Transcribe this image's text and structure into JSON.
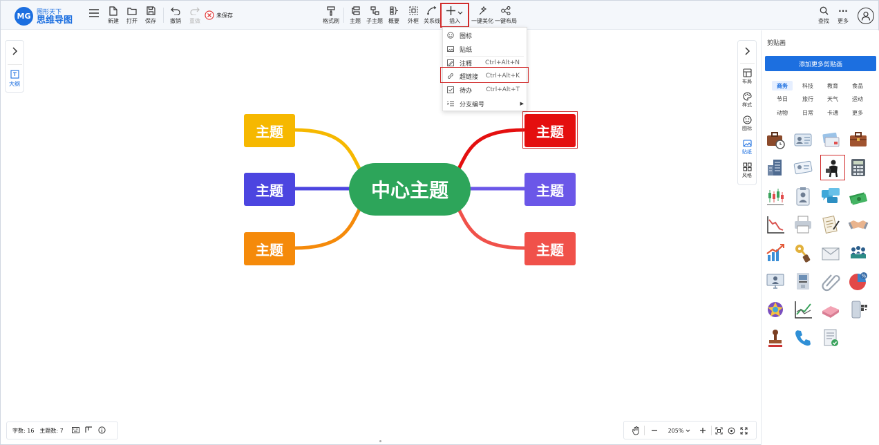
{
  "app": {
    "logo_mark": "MG",
    "logo_sub": "图形天下",
    "logo_main": "思维导图"
  },
  "toolbar": {
    "new": "新建",
    "open": "打开",
    "save": "保存",
    "undo": "撤销",
    "redo": "重做",
    "unsaved": "未保存",
    "format_painter": "格式刷",
    "topic": "主题",
    "subtopic": "子主题",
    "summary": "概要",
    "boundary": "外框",
    "relation": "关系线",
    "insert": "插入",
    "beautify": "一键美化",
    "layout": "一键布局",
    "find": "查找",
    "more": "更多"
  },
  "insert_menu": {
    "items": [
      {
        "label": "图标",
        "shortcut": "",
        "icon": "smiley-icon"
      },
      {
        "label": "贴纸",
        "shortcut": "",
        "icon": "image-icon"
      },
      {
        "label": "注释",
        "shortcut": "Ctrl+Alt+N",
        "icon": "note-icon"
      },
      {
        "label": "超链接",
        "shortcut": "Ctrl+Alt+K",
        "icon": "link-icon"
      },
      {
        "label": "待办",
        "shortcut": "Ctrl+Alt+T",
        "icon": "checkbox-icon"
      },
      {
        "label": "分支编号",
        "shortcut": "",
        "icon": "numbering-icon"
      }
    ]
  },
  "left_panel": {
    "outline": "大纲"
  },
  "right_panel": {
    "layout": "布局",
    "style": "样式",
    "icon": "图标",
    "sticker": "贴纸",
    "theme": "风格"
  },
  "mindmap": {
    "center": "中心主题",
    "topics": [
      {
        "label": "主题",
        "color": "#f6b800"
      },
      {
        "label": "主题",
        "color": "#4c45e0"
      },
      {
        "label": "主题",
        "color": "#f58a0a"
      },
      {
        "label": "主题",
        "color": "#e40f0f"
      },
      {
        "label": "主题",
        "color": "#6b57e8"
      },
      {
        "label": "主题",
        "color": "#f0514a"
      }
    ],
    "center_color": "#2da55a"
  },
  "sidebar": {
    "title": "剪贴画",
    "add_button": "添加更多剪贴画",
    "categories": [
      "商务",
      "科技",
      "教育",
      "食品",
      "节日",
      "旅行",
      "天气",
      "运动",
      "动物",
      "日常",
      "卡通",
      "更多"
    ],
    "selected_category": "商务"
  },
  "status": {
    "word_count": "字数: 16",
    "topic_count": "主题数: 7"
  },
  "zoom": {
    "level": "205%"
  }
}
